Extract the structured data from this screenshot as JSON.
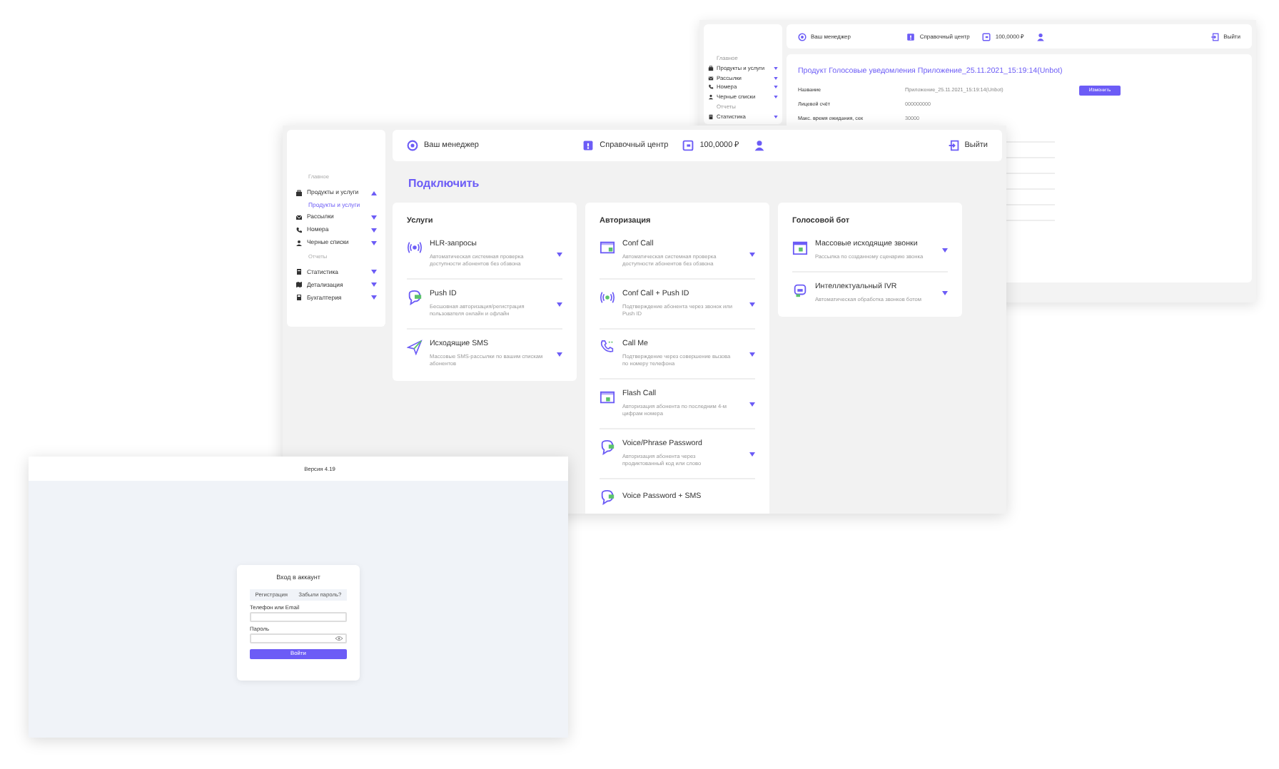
{
  "windows": [
    {
      "kind": "details",
      "sidebar": {
        "sections": [
          {
            "label": "Главное",
            "items": [
              {
                "label": "Продукты и услуги",
                "expanded": false
              },
              {
                "label": "Рассылки",
                "expanded": false
              },
              {
                "label": "Номера",
                "expanded": false
              },
              {
                "label": "Черные списки",
                "expanded": false
              }
            ]
          },
          {
            "label": "Отчеты",
            "items": [
              {
                "label": "Статистика",
                "expanded": false
              }
            ]
          }
        ]
      },
      "header": {
        "manager": "Ваш менеджер",
        "help": "Справочный центр",
        "balance": "100,0000 ₽",
        "logout": "Выйти"
      },
      "panel": {
        "title": "Продукт Голосовые уведомления Приложение_25.11.2021_15:19:14(Unbot)",
        "button": "Изменить",
        "fields": [
          {
            "label": "Название",
            "value": "Приложение_25.11.2021_15:19:14(Unbot)"
          },
          {
            "label": "Лицевой счёт",
            "value": "000000000"
          },
          {
            "label": "Макс. время ожидания, сек",
            "value": "30000"
          }
        ]
      }
    },
    {
      "kind": "catalog",
      "sidebar": {
        "sections": [
          {
            "label": "Главное",
            "items": [
              {
                "label": "Продукты и услуги",
                "expanded": true,
                "children": [
                  {
                    "label": "Продукты и услуги",
                    "selected": true
                  }
                ]
              },
              {
                "label": "Рассылки",
                "expanded": false
              },
              {
                "label": "Номера",
                "expanded": false
              },
              {
                "label": "Черные списки",
                "expanded": false
              }
            ]
          },
          {
            "label": "Отчеты",
            "items": [
              {
                "label": "Статистика",
                "expanded": false
              },
              {
                "label": "Детализация",
                "expanded": false
              },
              {
                "label": "Бухгалтерия",
                "expanded": false
              }
            ]
          }
        ]
      },
      "header": {
        "manager": "Ваш менеджер",
        "help": "Справочный центр",
        "balance": "100,0000 ₽",
        "logout": "Выйти"
      },
      "heading": "Подключить",
      "cards": [
        {
          "title": "Услуги",
          "items": [
            {
              "name": "HLR-запросы",
              "description": "Автоматическая системная проверка доступности абонентов без обзвона"
            },
            {
              "name": "Push ID",
              "description": "Бесшовная авторизация/регистрация пользователя онлайн и офлайн"
            },
            {
              "name": "Исходящие SMS",
              "description": "Массовые SMS-рассылки по вашим спискам абонентов"
            }
          ]
        },
        {
          "title": "Авторизация",
          "items": [
            {
              "name": "Conf Call",
              "description": "Автоматическая системная проверка доступности абонентов без обзвона"
            },
            {
              "name": "Conf Call + Push ID",
              "description": "Подтверждение абонента через звонок или Push ID"
            },
            {
              "name": "Call Me",
              "description": "Подтверждение через совершение вызова по номеру телефона"
            },
            {
              "name": "Flash Call",
              "description": "Авторизация абонента по последним 4-м цифрам номера"
            },
            {
              "name": "Voice/Phrase Password",
              "description": "Авторизация абонента через продиктованный код или слово"
            },
            {
              "name": "Voice Password + SMS"
            }
          ]
        },
        {
          "title": "Голосовой бот",
          "items": [
            {
              "name": "Массовые исходящие звонки",
              "description": "Рассылка по созданному сценарию звонка"
            },
            {
              "name": "Интеллектуальный IVR",
              "description": "Автоматическая обработка звонков ботом"
            }
          ]
        }
      ]
    },
    {
      "kind": "login",
      "version": "Версия 4.19",
      "form": {
        "title": "Вход в аккаунт",
        "tabs": [
          "Регистрация",
          "Забыли пароль?"
        ],
        "fields": [
          {
            "label": "Телефон или Email",
            "kind": "text"
          },
          {
            "label": "Пароль",
            "kind": "password"
          }
        ],
        "button": "Войти"
      }
    }
  ]
}
